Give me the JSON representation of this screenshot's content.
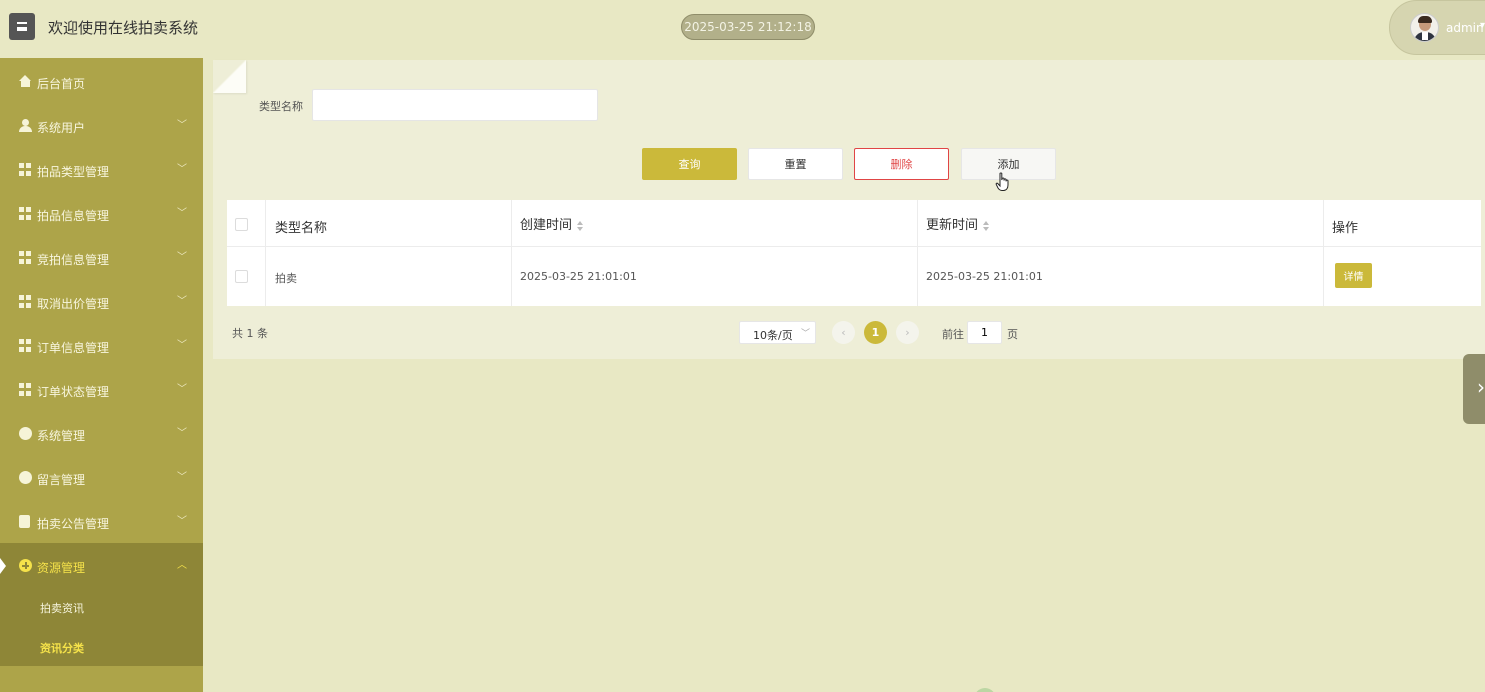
{
  "header": {
    "title": "欢迎使用在线拍卖系统",
    "datetime": "2025-03-25 21:12:18",
    "user": "admin"
  },
  "sidebar": {
    "items": [
      {
        "label": "后台首页",
        "icon": "home-icon"
      },
      {
        "label": "系统用户",
        "icon": "user-icon"
      },
      {
        "label": "拍品类型管理",
        "icon": "grid-icon"
      },
      {
        "label": "拍品信息管理",
        "icon": "grid-icon"
      },
      {
        "label": "竞拍信息管理",
        "icon": "grid-icon"
      },
      {
        "label": "取消出价管理",
        "icon": "grid-icon"
      },
      {
        "label": "订单信息管理",
        "icon": "grid-icon"
      },
      {
        "label": "订单状态管理",
        "icon": "grid-icon"
      },
      {
        "label": "系统管理",
        "icon": "gear-icon"
      },
      {
        "label": "留言管理",
        "icon": "gear-icon"
      },
      {
        "label": "拍卖公告管理",
        "icon": "document-icon"
      },
      {
        "label": "资源管理",
        "icon": "plus-circle-icon"
      }
    ],
    "sub_items": [
      {
        "label": "拍卖资讯"
      },
      {
        "label": "资讯分类"
      }
    ]
  },
  "search": {
    "label": "类型名称",
    "value": "",
    "placeholder": ""
  },
  "toolbar": {
    "query_label": "查询",
    "reset_label": "重置",
    "delete_label": "删除",
    "add_label": "添加"
  },
  "table": {
    "columns": [
      "类型名称",
      "创建时间",
      "更新时间",
      "操作"
    ],
    "rows": [
      {
        "type_name": "拍卖",
        "created": "2025-03-25 21:01:01",
        "updated": "2025-03-25 21:01:01",
        "action": "详情"
      }
    ]
  },
  "pagination": {
    "total": "共 1 条",
    "page_size": "10条/页",
    "current_page": "1",
    "goto_label": "前往",
    "goto_value": "1",
    "goto_suffix": "页"
  },
  "colors": {
    "sidebar": "#ada449",
    "sidebar_active": "#8e8637",
    "accent": "#cbb93a",
    "danger": "#e04545",
    "background": "#e8e8c4",
    "panel": "#eeeed7"
  }
}
